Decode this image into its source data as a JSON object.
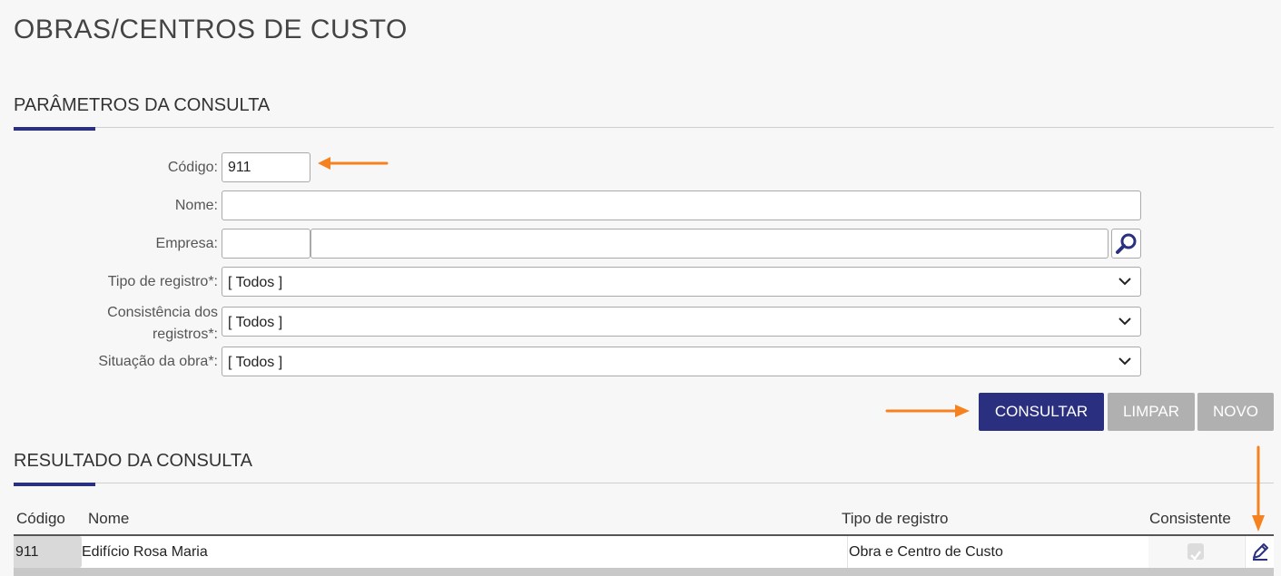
{
  "page": {
    "title": "OBRAS/CENTROS DE CUSTO"
  },
  "params": {
    "section_title": "PARÂMETROS DA CONSULTA",
    "codigo": {
      "label": "Código:",
      "value": "911"
    },
    "nome": {
      "label": "Nome:",
      "value": ""
    },
    "empresa": {
      "label": "Empresa:",
      "code_value": "",
      "name_value": "",
      "search_icon": "search-icon"
    },
    "tipo_registro": {
      "label": "Tipo de registro*:",
      "selected": "[ Todos ]"
    },
    "consistencia": {
      "label_line1": "Consistência dos",
      "label_line2": "registros*:",
      "selected": "[ Todos ]"
    },
    "situacao": {
      "label": "Situação da obra*:",
      "selected": "[ Todos ]"
    }
  },
  "buttons": {
    "consultar": "CONSULTAR",
    "limpar": "LIMPAR",
    "novo": "NOVO"
  },
  "results": {
    "section_title": "RESULTADO DA CONSULTA",
    "columns": [
      "Código",
      "Nome",
      "Tipo de registro",
      "Consistente"
    ],
    "rows": [
      {
        "codigo": "911",
        "nome": "Edifício Rosa Maria",
        "tipo": "Obra e Centro de Custo",
        "consistente": true
      }
    ]
  },
  "colors": {
    "primary": "#2b2f7f",
    "secondary_button": "#b0b0b0",
    "annotation_arrow": "#f5821f"
  }
}
